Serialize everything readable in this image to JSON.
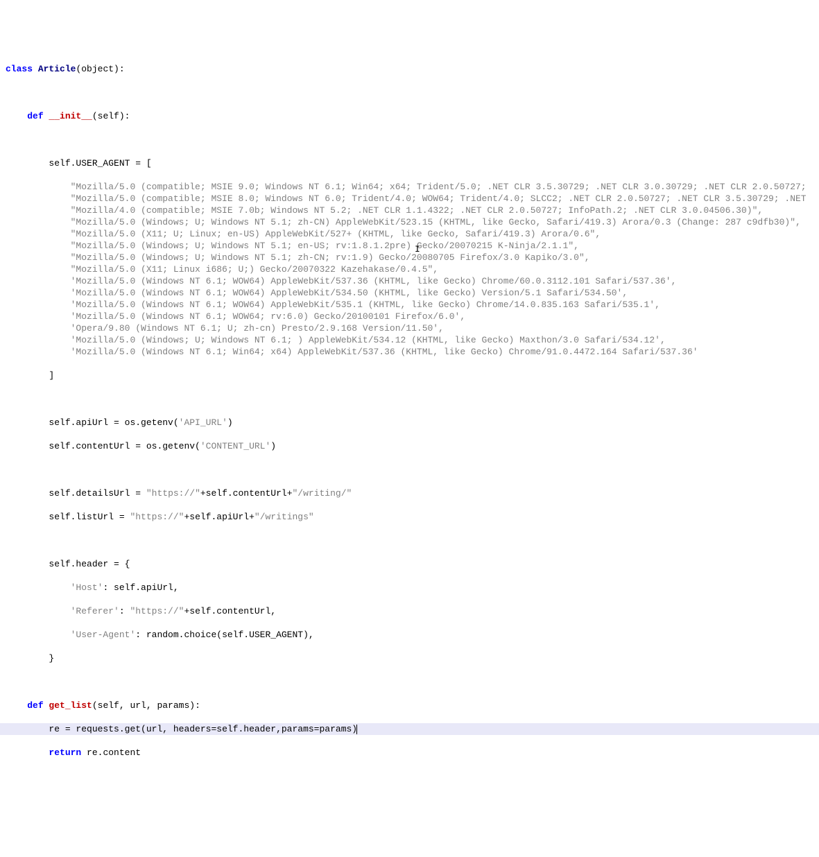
{
  "code": {
    "l1": {
      "kw": "class",
      "cls": " Article",
      "rest": "(object):"
    },
    "l2": "",
    "l3": {
      "indent": "    ",
      "kw": "def",
      "fn": " __init__",
      "rest": "(self):"
    },
    "l4": "",
    "l5": {
      "indent": "        ",
      "text": "self.USER_AGENT = ["
    },
    "ua": [
      "\"Mozilla/5.0 (compatible; MSIE 9.0; Windows NT 6.1; Win64; x64; Trident/5.0; .NET CLR 3.5.30729; .NET CLR 3.0.30729; .NET CLR 2.0.50727;",
      "\"Mozilla/5.0 (compatible; MSIE 8.0; Windows NT 6.0; Trident/4.0; WOW64; Trident/4.0; SLCC2; .NET CLR 2.0.50727; .NET CLR 3.5.30729; .NET",
      "\"Mozilla/4.0 (compatible; MSIE 7.0b; Windows NT 5.2; .NET CLR 1.1.4322; .NET CLR 2.0.50727; InfoPath.2; .NET CLR 3.0.04506.30)\",",
      "\"Mozilla/5.0 (Windows; U; Windows NT 5.1; zh-CN) AppleWebKit/523.15 (KHTML, like Gecko, Safari/419.3) Arora/0.3 (Change: 287 c9dfb30)\",",
      "\"Mozilla/5.0 (X11; U; Linux; en-US) AppleWebKit/527+ (KHTML, like Gecko, Safari/419.3) Arora/0.6\",",
      "\"Mozilla/5.0 (Windows; U; Windows NT 5.1; en-US; rv:1.8.1.2pre) Gecko/20070215 K-Ninja/2.1.1\",",
      "\"Mozilla/5.0 (Windows; U; Windows NT 5.1; zh-CN; rv:1.9) Gecko/20080705 Firefox/3.0 Kapiko/3.0\",",
      "\"Mozilla/5.0 (X11; Linux i686; U;) Gecko/20070322 Kazehakase/0.4.5\",",
      "'Mozilla/5.0 (Windows NT 6.1; WOW64) AppleWebKit/537.36 (KHTML, like Gecko) Chrome/60.0.3112.101 Safari/537.36',",
      "'Mozilla/5.0 (Windows NT 6.1; WOW64) AppleWebKit/534.50 (KHTML, like Gecko) Version/5.1 Safari/534.50',",
      "'Mozilla/5.0 (Windows NT 6.1; WOW64) AppleWebKit/535.1 (KHTML, like Gecko) Chrome/14.0.835.163 Safari/535.1',",
      "'Mozilla/5.0 (Windows NT 6.1; WOW64; rv:6.0) Gecko/20100101 Firefox/6.0',",
      "'Opera/9.80 (Windows NT 6.1; U; zh-cn) Presto/2.9.168 Version/11.50',",
      "'Mozilla/5.0 (Windows; U; Windows NT 6.1; ) AppleWebKit/534.12 (KHTML, like Gecko) Maxthon/3.0 Safari/534.12',",
      "'Mozilla/5.0 (Windows NT 6.1; Win64; x64) AppleWebKit/537.36 (KHTML, like Gecko) Chrome/91.0.4472.164 Safari/537.36'"
    ],
    "l6": {
      "indent": "        ",
      "text": "]"
    },
    "l7": "",
    "apiurl": {
      "indent": "        ",
      "pre": "self.apiUrl = os.getenv(",
      "str": "'API_URL'",
      "post": ")"
    },
    "contenturl": {
      "indent": "        ",
      "pre": "self.contentUrl = os.getenv(",
      "str": "'CONTENT_URL'",
      "post": ")"
    },
    "l8": "",
    "detailsurl": {
      "indent": "        ",
      "pre": "self.detailsUrl = ",
      "s1": "\"https://\"",
      "mid": "+self.contentUrl+",
      "s2": "\"/writing/\""
    },
    "listurl": {
      "indent": "        ",
      "pre": "self.listUrl = ",
      "s1": "\"https://\"",
      "mid": "+self.apiUrl+",
      "s2": "\"/writings\""
    },
    "l9": "",
    "header_open": {
      "indent": "        ",
      "text": "self.header = {"
    },
    "h_host": {
      "indent": "            ",
      "k": "'Host'",
      "v": ": self.apiUrl,"
    },
    "h_ref": {
      "indent": "            ",
      "k": "'Referer'",
      "mid": ": ",
      "s": "\"https://\"",
      "post": "+self.contentUrl,"
    },
    "h_ua": {
      "indent": "            ",
      "k": "'User-Agent'",
      "v": ": random.choice(self.USER_AGENT),"
    },
    "header_close": {
      "indent": "        ",
      "text": "}"
    },
    "l10": "",
    "getlist": {
      "indent": "    ",
      "kw": "def",
      "fn": " get_list",
      "rest": "(self, url, params):"
    },
    "req": {
      "indent": "        ",
      "text": "re = requests.get(url, headers=self.header,params=params)"
    },
    "ret": {
      "indent": "        ",
      "kw": "return",
      "rest": " re.content"
    }
  },
  "cursor": {
    "text": "I"
  }
}
